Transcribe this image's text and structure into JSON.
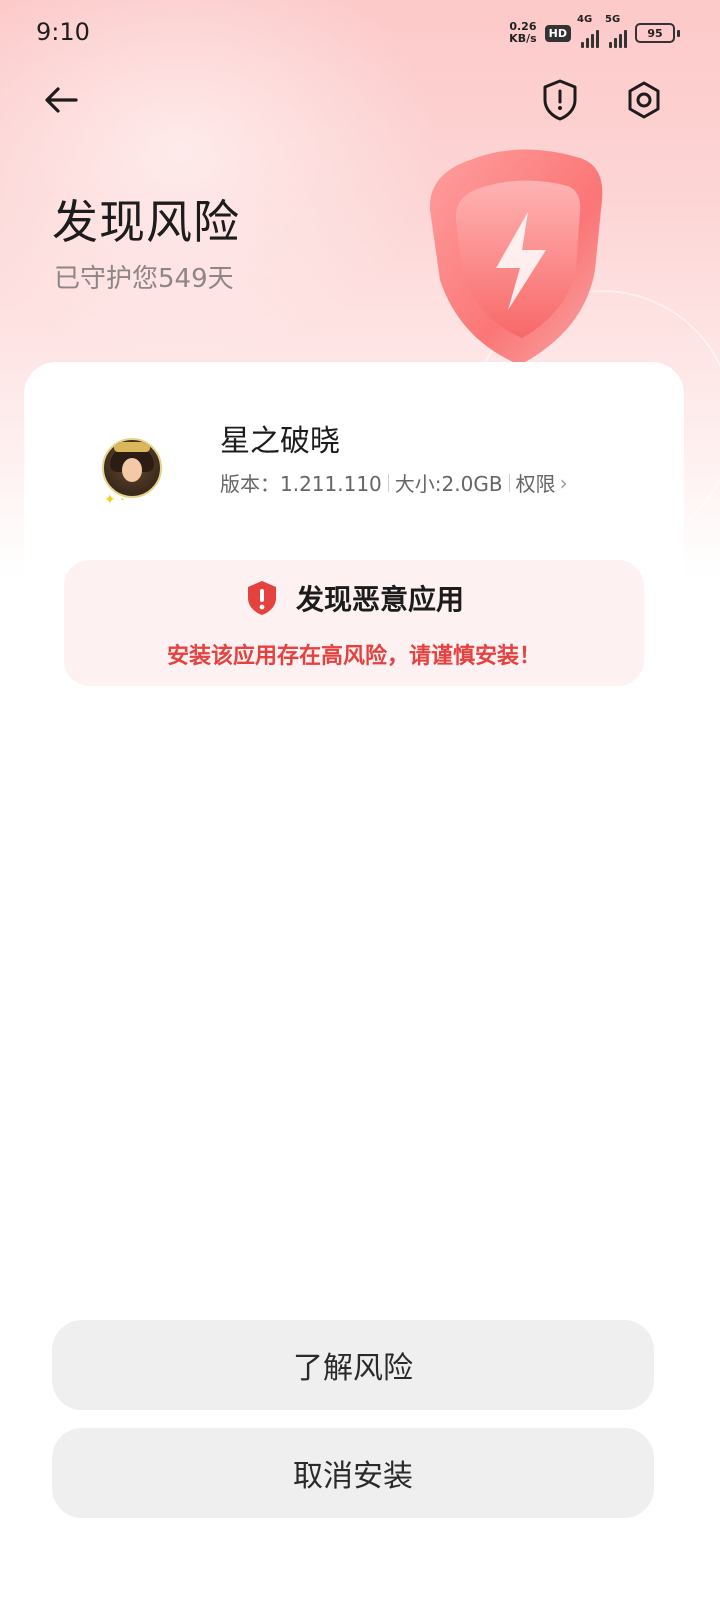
{
  "status_bar": {
    "time": "9:10",
    "net_speed_value": "0.26",
    "net_speed_unit": "KB/s",
    "hd_label": "HD",
    "network_1": "4G",
    "network_2": "5G",
    "battery": "95"
  },
  "nav": {
    "back_icon": "arrow-left-icon",
    "shield_icon": "shield-alert-icon",
    "settings_icon": "settings-icon"
  },
  "header": {
    "title": "发现风险",
    "subtitle": "已守护您549天"
  },
  "app": {
    "name": "星之破晓",
    "version_label": "版本：1.211.110",
    "size_label": "大小:2.0GB",
    "permissions_label": "权限"
  },
  "warning": {
    "title": "发现恶意应用",
    "message": "安装该应用存在高风险，请谨慎安装！",
    "color": "#e5413f"
  },
  "actions": {
    "learn_risk": "了解风险",
    "cancel_install": "取消安装"
  }
}
